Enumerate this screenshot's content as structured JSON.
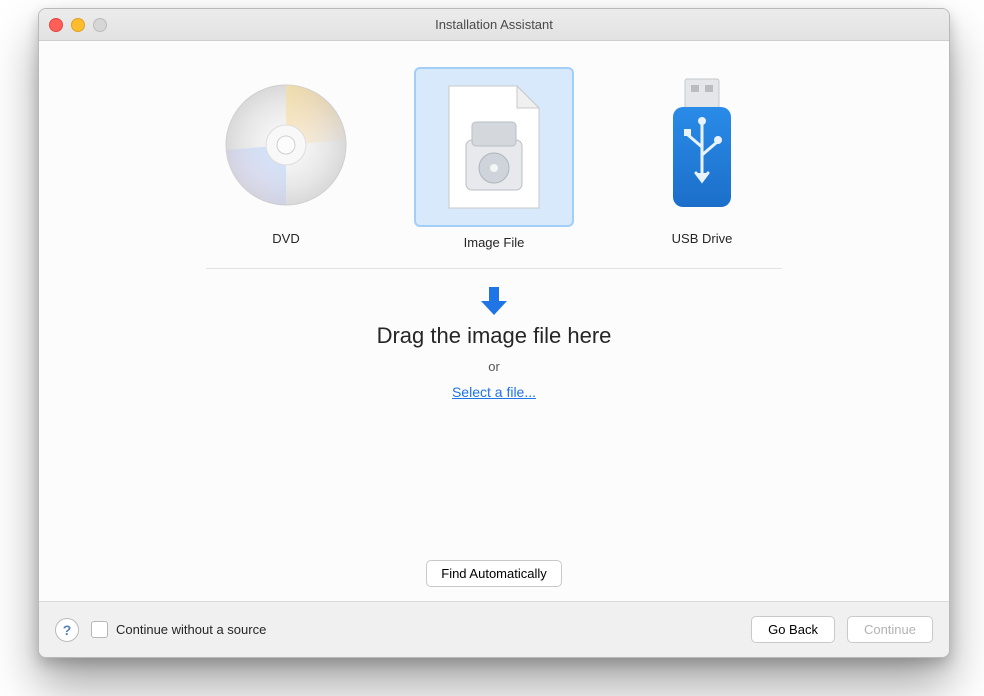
{
  "window": {
    "title": "Installation Assistant"
  },
  "choices": {
    "dvd": {
      "label": "DVD"
    },
    "image": {
      "label": "Image File"
    },
    "usb": {
      "label": "USB Drive"
    }
  },
  "drop": {
    "headline": "Drag the image file here",
    "or": "or",
    "link": "Select a file..."
  },
  "buttons": {
    "find_auto": "Find Automatically",
    "go_back": "Go Back",
    "continue": "Continue"
  },
  "footer": {
    "continue_without_source": "Continue without a source"
  },
  "help_glyph": "?"
}
